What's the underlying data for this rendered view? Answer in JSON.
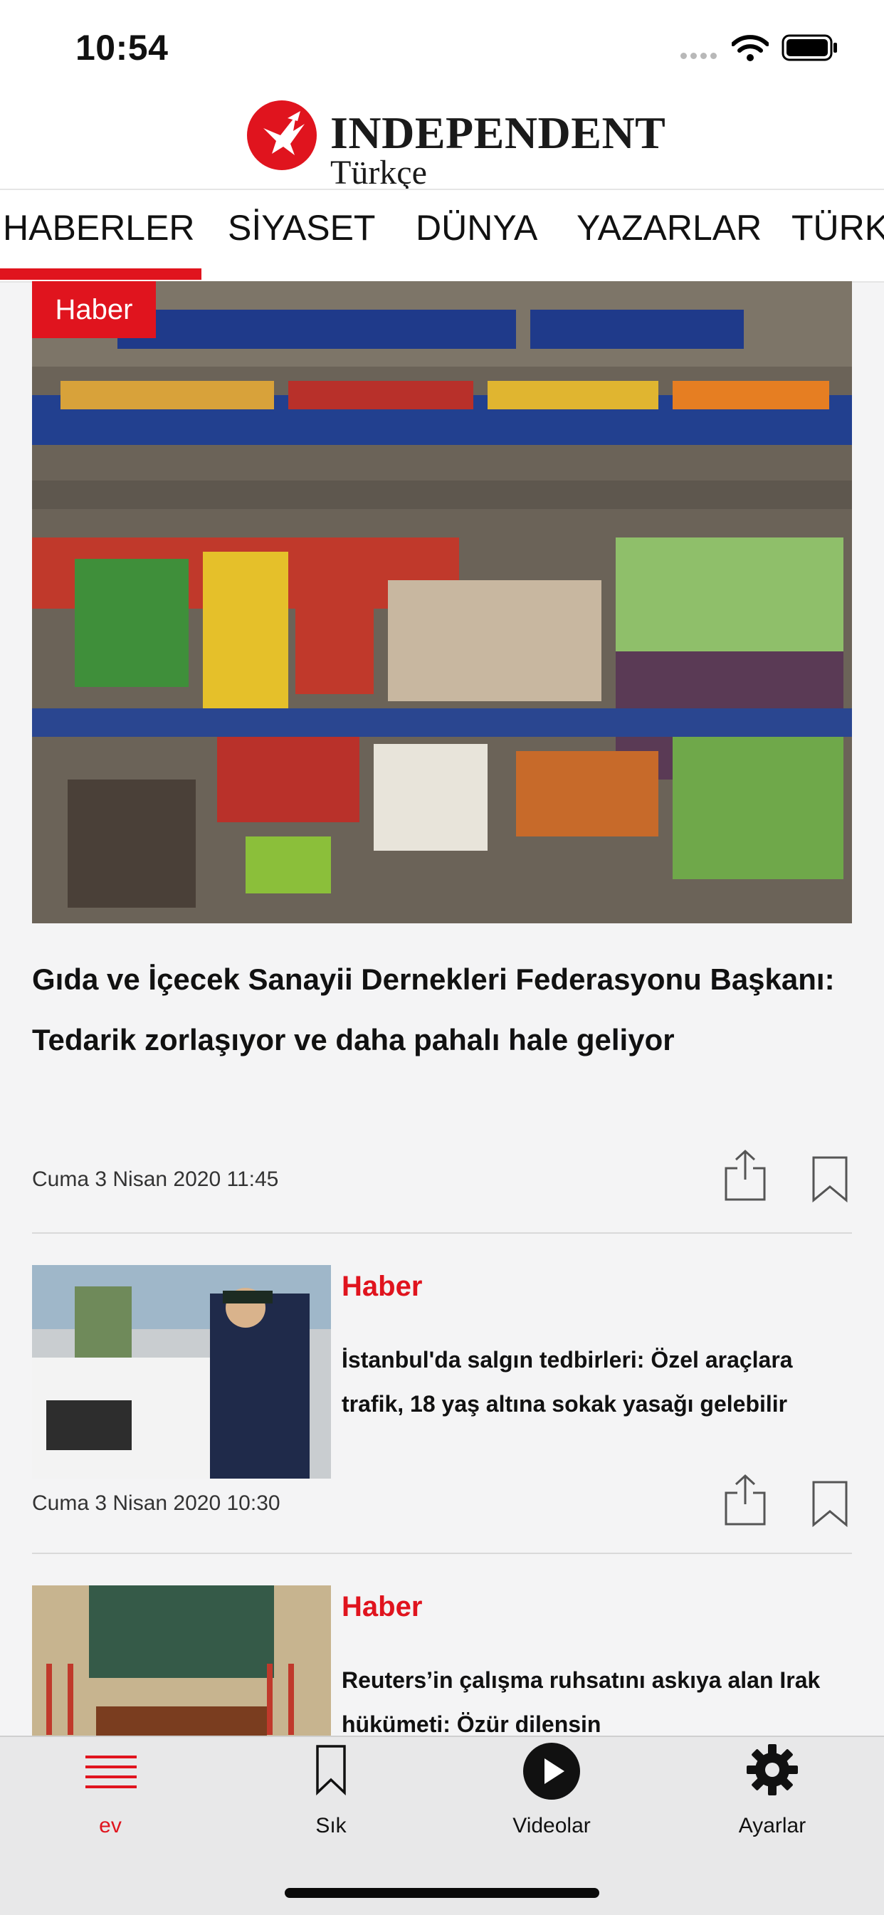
{
  "status_bar": {
    "time": "10:54"
  },
  "header": {
    "brand_name": "INDEPENDENT",
    "brand_sub": "Türkçe"
  },
  "nav_tabs": [
    {
      "label": "HABERLER",
      "active": true
    },
    {
      "label": "SİYASET"
    },
    {
      "label": "DÜNYA"
    },
    {
      "label": "YAZARLAR"
    },
    {
      "label": "TÜRK"
    }
  ],
  "featured": {
    "badge": "Haber",
    "title": "Gıda ve İçecek Sanayii Dernekleri Federasyonu Başkanı: Tedarik zorlaşıyor ve daha pahalı hale geliyor",
    "date": "Cuma 3 Nisan 2020 11:45"
  },
  "articles": [
    {
      "category": "Haber",
      "title": "İstanbul'da salgın tedbirleri: Özel araçlara trafik, 18 yaş altına sokak yasağı gelebilir",
      "date": "Cuma 3 Nisan 2020 10:30"
    },
    {
      "category": "Haber",
      "title": "Reuters’in çalışma ruhsatını askıya alan Irak hükümeti: Özür dilensin"
    }
  ],
  "tab_bar": [
    {
      "label": "ev",
      "icon": "menu-lines-icon",
      "active": true
    },
    {
      "label": "Sık",
      "icon": "bookmark-icon"
    },
    {
      "label": "Videolar",
      "icon": "play-circle-icon"
    },
    {
      "label": "Ayarlar",
      "icon": "gear-icon"
    }
  ],
  "colors": {
    "accent": "#e0141e",
    "background": "#f4f4f5",
    "tab_bar": "#e8e8e9"
  }
}
